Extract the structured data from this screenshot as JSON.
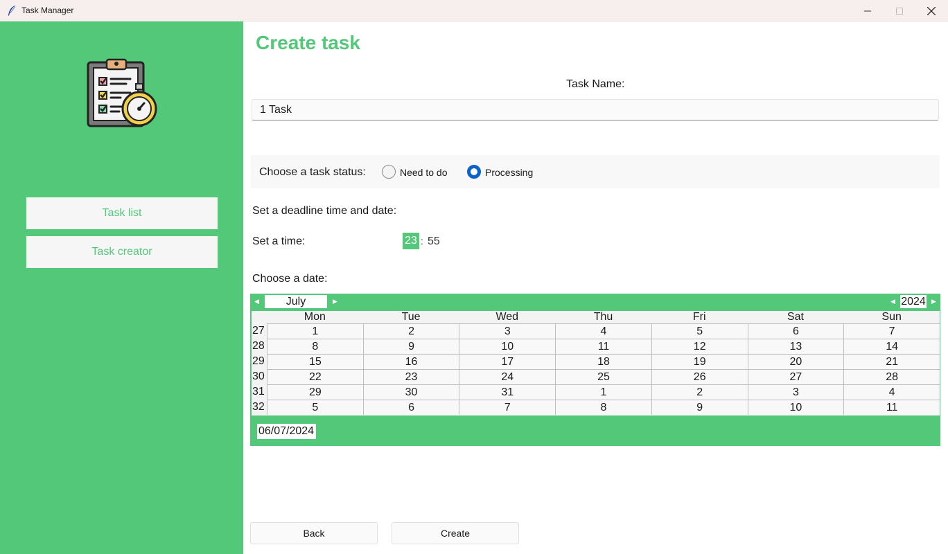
{
  "window": {
    "title": "Task Manager"
  },
  "sidebar": {
    "logo_icon": "clipboard-checklist-stopwatch-icon",
    "items": [
      {
        "label": "Task list"
      },
      {
        "label": "Task creator"
      }
    ]
  },
  "main": {
    "title": "Create task",
    "task_name_label": "Task Name:",
    "task_name_value": "1 Task",
    "status_label": "Choose a task status:",
    "status_options": [
      {
        "label": "Need to do",
        "selected": false
      },
      {
        "label": "Processing",
        "selected": true
      }
    ],
    "deadline_label": "Set a deadline time and date:",
    "time_label": "Set a time:",
    "time_hour": "23",
    "time_separator": ":",
    "time_minute": "55",
    "date_label": "Choose a date:"
  },
  "calendar": {
    "month": "July",
    "year": "2024",
    "weekdays": [
      "Mon",
      "Tue",
      "Wed",
      "Thu",
      "Fri",
      "Sat",
      "Sun"
    ],
    "weeks": [
      {
        "number": "27",
        "days": [
          "1",
          "2",
          "3",
          "4",
          "5",
          "6",
          "7"
        ]
      },
      {
        "number": "28",
        "days": [
          "8",
          "9",
          "10",
          "11",
          "12",
          "13",
          "14"
        ]
      },
      {
        "number": "29",
        "days": [
          "15",
          "16",
          "17",
          "18",
          "19",
          "20",
          "21"
        ]
      },
      {
        "number": "30",
        "days": [
          "22",
          "23",
          "24",
          "25",
          "26",
          "27",
          "28"
        ]
      },
      {
        "number": "31",
        "days": [
          "29",
          "30",
          "31",
          "1",
          "2",
          "3",
          "4"
        ]
      },
      {
        "number": "32",
        "days": [
          "5",
          "6",
          "7",
          "8",
          "9",
          "10",
          "11"
        ]
      }
    ],
    "selected_date": "06/07/2024"
  },
  "buttons": {
    "back": "Back",
    "create": "Create"
  },
  "colors": {
    "accent": "#52c878",
    "radio_selected": "#0a64c8",
    "titlebar": "#f7eeee"
  }
}
